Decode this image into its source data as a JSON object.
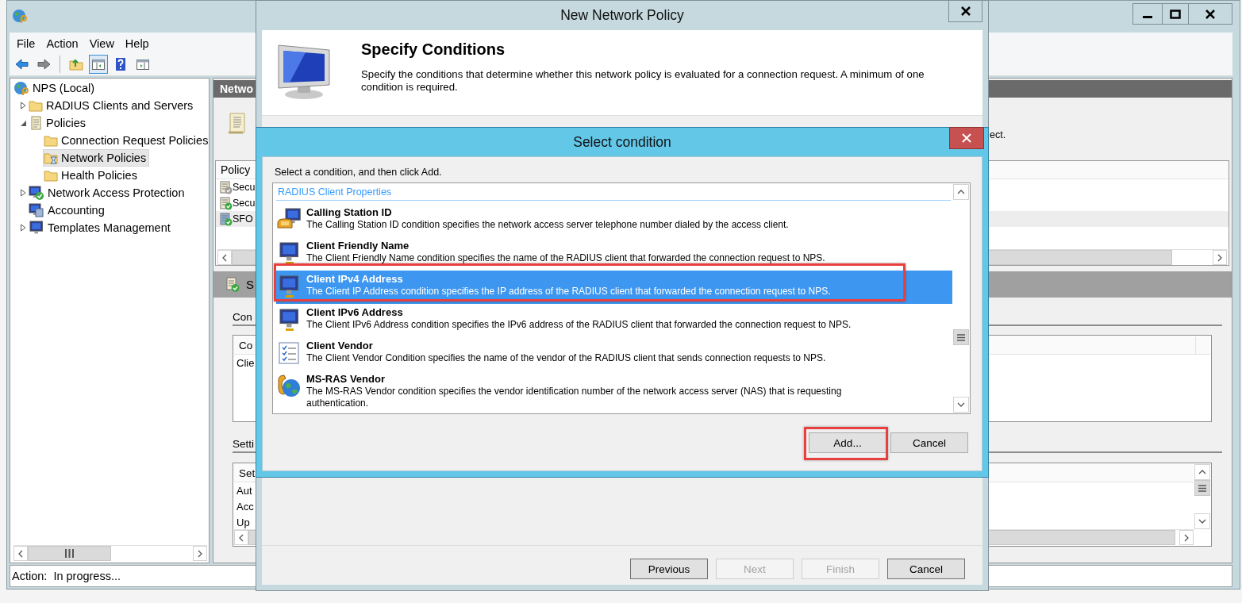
{
  "main_window": {
    "menu": [
      "File",
      "Action",
      "View",
      "Help"
    ],
    "toolbar": [
      {
        "kind": "back",
        "pressed": false
      },
      {
        "kind": "forward",
        "pressed": false
      },
      {
        "kind": "up_folder",
        "pressed": false
      },
      {
        "kind": "tree_toggle",
        "pressed": true
      },
      {
        "kind": "help",
        "pressed": false
      },
      {
        "kind": "pane_toggle",
        "pressed": false
      }
    ],
    "tree": [
      {
        "label": "NPS (Local)",
        "kind": "root",
        "expandable": false,
        "selected": false,
        "children": [
          {
            "label": "RADIUS Clients and Servers",
            "kind": "folder",
            "expandable": true,
            "expanded": false,
            "selected": false
          },
          {
            "label": "Policies",
            "kind": "scroll",
            "expandable": true,
            "expanded": true,
            "selected": false,
            "children": [
              {
                "label": "Connection Request Policies",
                "kind": "folder",
                "expandable": false,
                "selected": false
              },
              {
                "label": "Network Policies",
                "kind": "busy_folder",
                "expandable": false,
                "selected": true
              },
              {
                "label": "Health Policies",
                "kind": "folder",
                "expandable": false,
                "selected": false
              }
            ]
          },
          {
            "label": "Network Access Protection",
            "kind": "protected_computer",
            "expandable": true,
            "expanded": false,
            "selected": false
          },
          {
            "label": "Accounting",
            "kind": "computers",
            "expandable": false,
            "selected": false
          },
          {
            "label": "Templates Management",
            "kind": "monitor",
            "expandable": true,
            "expanded": false,
            "selected": false
          }
        ]
      }
    ],
    "details": {
      "header": "Netwo",
      "intro_text": "ect.",
      "policy_list": {
        "column_1": "Policy",
        "rows": [
          {
            "name": "Secu",
            "kind": "disabled",
            "selected": false
          },
          {
            "name": "Secu",
            "kind": "enabled",
            "selected": false
          },
          {
            "name": "SFO",
            "kind": "new",
            "selected": true
          }
        ]
      },
      "summary_band": "S",
      "conditions": {
        "label": "Con",
        "column_1": "Co",
        "rows": [
          "Clie"
        ]
      },
      "settings": {
        "label": "Setti",
        "column_1": "Set",
        "rows": [
          "Aut",
          "Acc",
          "Up"
        ]
      }
    },
    "status_bar": "Action:  In progress..."
  },
  "wizard": {
    "title": "New Network Policy",
    "heading": "Specify Conditions",
    "description": "Specify the conditions that determine whether this network policy is evaluated for a connection request. A minimum of one condition is required.",
    "buttons": [
      {
        "label": "Previous",
        "disabled": false
      },
      {
        "label": "Next",
        "disabled": true
      },
      {
        "label": "Finish",
        "disabled": true
      },
      {
        "label": "Cancel",
        "disabled": false
      }
    ]
  },
  "dialog": {
    "title": "Select condition",
    "instruction": "Select a condition, and then click Add.",
    "group": "RADIUS Client Properties",
    "conditions": [
      {
        "name": "Calling Station ID",
        "description": "The Calling Station ID condition specifies the network access server telephone number dialed by the access client.",
        "kind": "phone_computer",
        "selected": false,
        "highlighted": false
      },
      {
        "name": "Client Friendly Name",
        "description": "The Client Friendly Name condition specifies the name of the RADIUS client that forwarded the connection request to NPS.",
        "kind": "computer",
        "selected": false,
        "highlighted": false
      },
      {
        "name": "Client IPv4 Address",
        "description": "The Client IP Address condition specifies the IP address of the RADIUS client that forwarded the connection request to NPS.",
        "kind": "computer",
        "selected": true,
        "highlighted": true
      },
      {
        "name": "Client IPv6 Address",
        "description": "The Client IPv6 Address condition specifies the IPv6 address of the RADIUS client that forwarded the connection request to NPS.",
        "kind": "computer",
        "selected": false,
        "highlighted": false
      },
      {
        "name": "Client Vendor",
        "description": "The Client Vendor Condition specifies the name of the vendor of the RADIUS client that sends connection requests to NPS.",
        "kind": "checklist",
        "selected": false,
        "highlighted": false
      },
      {
        "name": "MS-RAS Vendor",
        "description": "The MS-RAS Vendor condition specifies the vendor identification number of the network access server (NAS) that is requesting authentication.",
        "kind": "phone_globe",
        "selected": false,
        "highlighted": false
      }
    ],
    "buttons": [
      {
        "label": "Add...",
        "highlighted": true
      },
      {
        "label": "Cancel",
        "highlighted": false
      }
    ]
  }
}
